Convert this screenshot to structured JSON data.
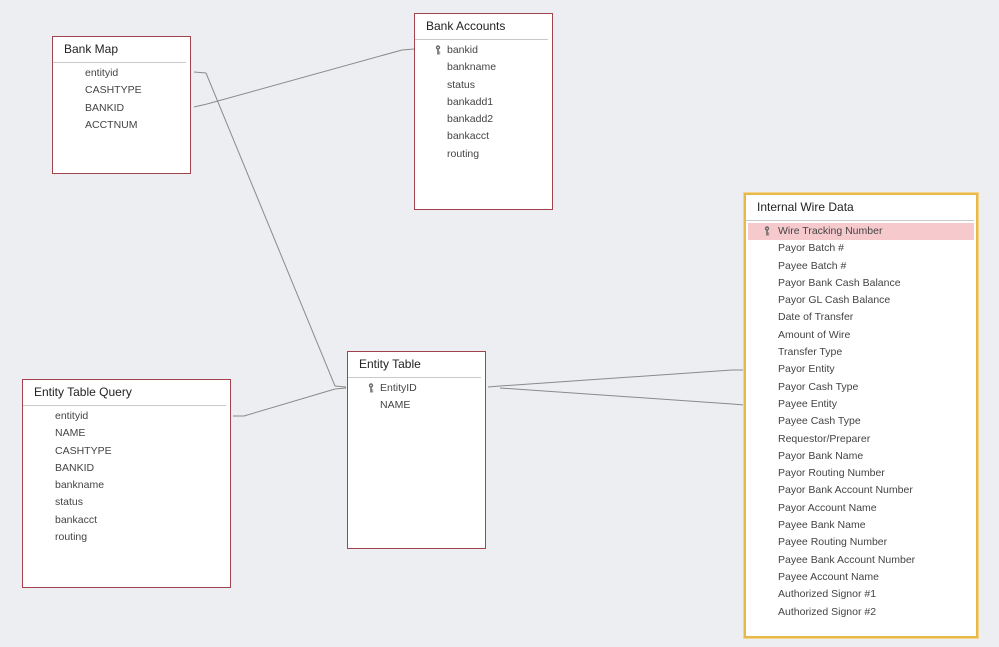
{
  "colors": {
    "canvas": "#eceef2",
    "table_border": "#a0434f",
    "selected_border": "#e8b84a",
    "highlight_row": "#f6c9cd",
    "relationship_line": "#8a8a8a"
  },
  "tables": {
    "bank_map": {
      "title": "Bank Map",
      "fields": [
        "entityid",
        "CASHTYPE",
        "BANKID",
        "ACCTNUM"
      ]
    },
    "bank_accounts": {
      "title": "Bank Accounts",
      "primary_key": "bankid",
      "fields": [
        "bankid",
        "bankname",
        "status",
        "bankadd1",
        "bankadd2",
        "bankacct",
        "routing"
      ]
    },
    "internal_wire_data": {
      "title": "Internal Wire Data",
      "primary_key": "Wire Tracking Number",
      "selected_field": "Wire Tracking Number",
      "fields": [
        "Wire Tracking Number",
        "Payor Batch #",
        "Payee Batch #",
        "Payor Bank Cash Balance",
        "Payor GL Cash Balance",
        "Date of Transfer",
        "Amount of Wire",
        "Transfer Type",
        "Payor Entity",
        "Payor Cash Type",
        "Payee Entity",
        "Payee Cash Type",
        "Requestor/Preparer",
        "Payor Bank Name",
        "Payor Routing Number",
        "Payor Bank Account Number",
        "Payor Account Name",
        "Payee Bank Name",
        "Payee Routing Number",
        "Payee Bank Account Number",
        "Payee Account Name",
        "Authorized Signor #1",
        "Authorized Signor #2"
      ]
    },
    "entity_table": {
      "title": "Entity Table",
      "primary_key": "EntityID",
      "fields": [
        "EntityID",
        "NAME"
      ]
    },
    "entity_table_query": {
      "title": "Entity Table Query",
      "fields": [
        "entityid",
        "NAME",
        "CASHTYPE",
        "BANKID",
        "bankname",
        "status",
        "bankacct",
        "routing"
      ]
    }
  }
}
